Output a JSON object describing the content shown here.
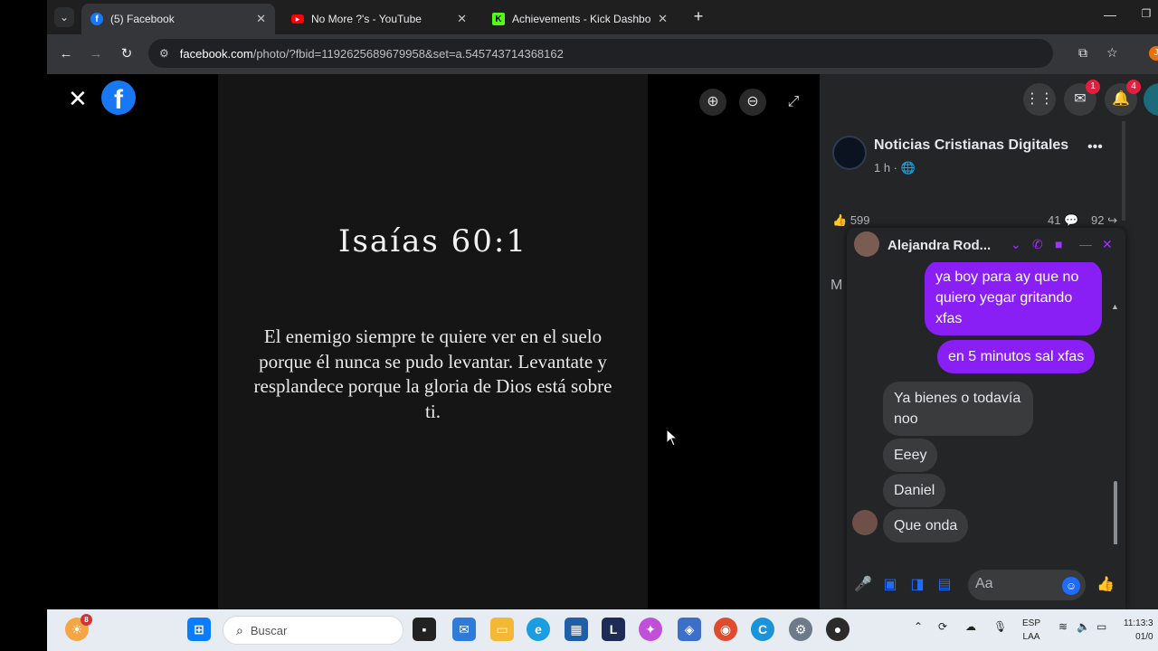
{
  "browser": {
    "tabs": [
      {
        "title": "(5) Facebook",
        "icon": "facebook-icon",
        "active": true
      },
      {
        "title": "No More ?'s - YouTube",
        "icon": "youtube-icon",
        "active": false
      },
      {
        "title": "Achievements - Kick Dashboard",
        "icon": "kick-icon",
        "active": false
      }
    ],
    "url_host": "facebook.com",
    "url_path": "/photo/?fbid=1192625689679958&set=a.545743714368162",
    "profile_initial": "J"
  },
  "viewer": {
    "verse_title": "Isaías 60:1",
    "verse_text": "El enemigo siempre te quiere ver en el suelo porque él nunca se pudo levantar. Levantate y resplandece porque la gloria de Dios está sobre ti."
  },
  "sidebar": {
    "messenger_badge": "1",
    "notifications_badge": "4",
    "post": {
      "page_name": "Noticias Cristianas Digitales",
      "time": "1 h ·",
      "reactions_count": "599",
      "comments_count": "41",
      "shares_count": "92"
    },
    "peek_letter": "M"
  },
  "chat": {
    "name": "Alejandra Rod...",
    "messages": [
      {
        "from": "me",
        "text": "ya boy para ay que no quiero yegar gritando xfas"
      },
      {
        "from": "me",
        "text": "en 5 minutos sal xfas"
      },
      {
        "from": "them",
        "text": "Ya bienes o todavía noo"
      },
      {
        "from": "them",
        "text": "Eeey"
      },
      {
        "from": "them",
        "text": "Daniel"
      },
      {
        "from": "them",
        "text": "Que onda"
      }
    ],
    "input_placeholder": "Aa",
    "accent": "#8a1ff5"
  },
  "taskbar": {
    "start_badge": "8",
    "search_placeholder": "Buscar",
    "lang_line1": "ESP",
    "lang_line2": "LAA",
    "time": "11:13:3",
    "date": "01/0"
  }
}
